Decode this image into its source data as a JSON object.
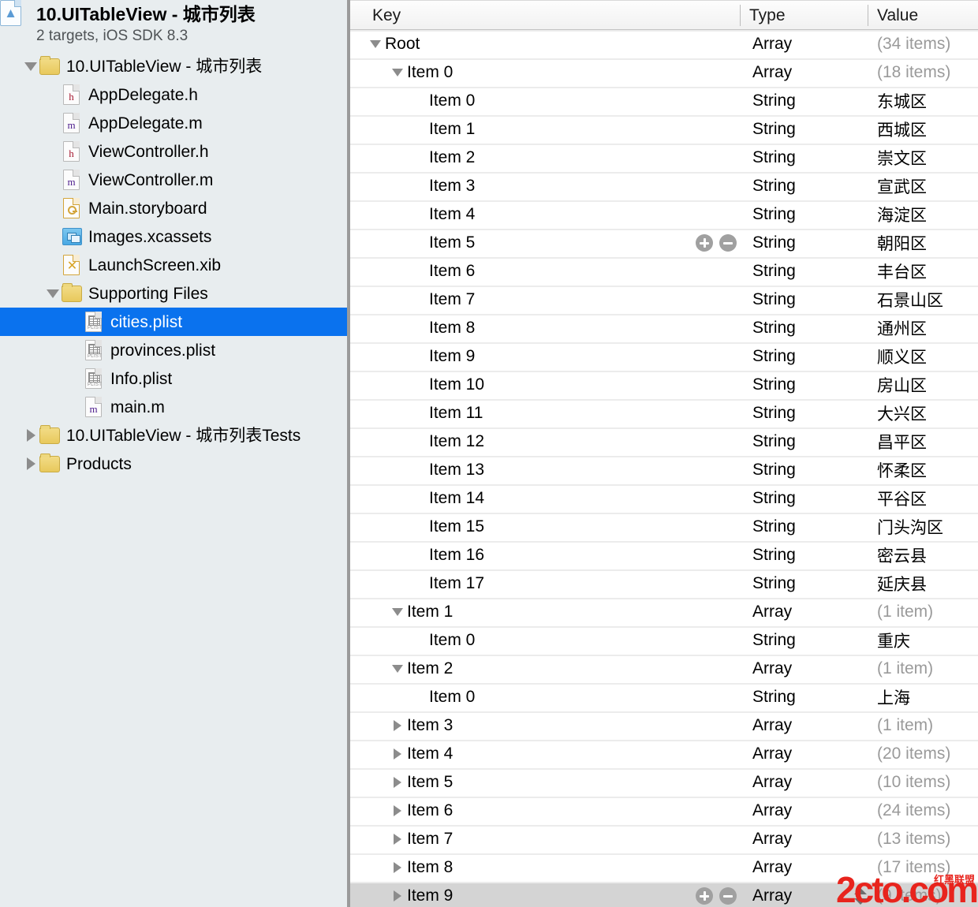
{
  "sidebar": {
    "project": {
      "title": "10.UITableView - 城市列表",
      "subtitle": "2 targets, iOS SDK 8.3",
      "icon": "xcode-project-icon"
    },
    "items": [
      {
        "label": "10.UITableView - 城市列表",
        "icon": "folder-icon",
        "depth": 1,
        "twisty": "down",
        "selected": false
      },
      {
        "label": "AppDelegate.h",
        "icon": "header-file-icon",
        "depth": 2,
        "twisty": "none",
        "selected": false
      },
      {
        "label": "AppDelegate.m",
        "icon": "objc-file-icon",
        "depth": 2,
        "twisty": "none",
        "selected": false
      },
      {
        "label": "ViewController.h",
        "icon": "header-file-icon",
        "depth": 2,
        "twisty": "none",
        "selected": false
      },
      {
        "label": "ViewController.m",
        "icon": "objc-file-icon",
        "depth": 2,
        "twisty": "none",
        "selected": false
      },
      {
        "label": "Main.storyboard",
        "icon": "storyboard-icon",
        "depth": 2,
        "twisty": "none",
        "selected": false
      },
      {
        "label": "Images.xcassets",
        "icon": "xcassets-icon",
        "depth": 2,
        "twisty": "none",
        "selected": false
      },
      {
        "label": "LaunchScreen.xib",
        "icon": "xib-icon",
        "depth": 2,
        "twisty": "none",
        "selected": false
      },
      {
        "label": "Supporting Files",
        "icon": "folder-icon",
        "depth": 2,
        "twisty": "down",
        "selected": false
      },
      {
        "label": "cities.plist",
        "icon": "plist-icon",
        "depth": 3,
        "twisty": "none",
        "selected": true
      },
      {
        "label": "provinces.plist",
        "icon": "plist-icon",
        "depth": 3,
        "twisty": "none",
        "selected": false
      },
      {
        "label": "Info.plist",
        "icon": "plist-icon",
        "depth": 3,
        "twisty": "none",
        "selected": false
      },
      {
        "label": "main.m",
        "icon": "objc-file-icon",
        "depth": 3,
        "twisty": "none",
        "selected": false
      },
      {
        "label": "10.UITableView - 城市列表Tests",
        "icon": "folder-icon",
        "depth": 1,
        "twisty": "right",
        "selected": false
      },
      {
        "label": "Products",
        "icon": "folder-icon",
        "depth": 1,
        "twisty": "right",
        "selected": false
      }
    ]
  },
  "table": {
    "columns": {
      "key": "Key",
      "type": "Type",
      "value": "Value"
    },
    "rows": [
      {
        "key": "Root",
        "type": "Array",
        "value": "(34 items)",
        "depth": 0,
        "twisty": "down",
        "muted": true,
        "selected": false,
        "buttons": false,
        "stepper": false
      },
      {
        "key": "Item 0",
        "type": "Array",
        "value": "(18 items)",
        "depth": 1,
        "twisty": "down",
        "muted": true,
        "selected": false,
        "buttons": false,
        "stepper": false
      },
      {
        "key": "Item 0",
        "type": "String",
        "value": "东城区",
        "depth": 2,
        "twisty": "none",
        "muted": false,
        "selected": false,
        "buttons": false,
        "stepper": false
      },
      {
        "key": "Item 1",
        "type": "String",
        "value": "西城区",
        "depth": 2,
        "twisty": "none",
        "muted": false,
        "selected": false,
        "buttons": false,
        "stepper": false
      },
      {
        "key": "Item 2",
        "type": "String",
        "value": "崇文区",
        "depth": 2,
        "twisty": "none",
        "muted": false,
        "selected": false,
        "buttons": false,
        "stepper": false
      },
      {
        "key": "Item 3",
        "type": "String",
        "value": "宣武区",
        "depth": 2,
        "twisty": "none",
        "muted": false,
        "selected": false,
        "buttons": false,
        "stepper": false
      },
      {
        "key": "Item 4",
        "type": "String",
        "value": "海淀区",
        "depth": 2,
        "twisty": "none",
        "muted": false,
        "selected": false,
        "buttons": false,
        "stepper": false
      },
      {
        "key": "Item 5",
        "type": "String",
        "value": "朝阳区",
        "depth": 2,
        "twisty": "none",
        "muted": false,
        "selected": false,
        "buttons": true,
        "stepper": false
      },
      {
        "key": "Item 6",
        "type": "String",
        "value": "丰台区",
        "depth": 2,
        "twisty": "none",
        "muted": false,
        "selected": false,
        "buttons": false,
        "stepper": false
      },
      {
        "key": "Item 7",
        "type": "String",
        "value": "石景山区",
        "depth": 2,
        "twisty": "none",
        "muted": false,
        "selected": false,
        "buttons": false,
        "stepper": false
      },
      {
        "key": "Item 8",
        "type": "String",
        "value": "通州区",
        "depth": 2,
        "twisty": "none",
        "muted": false,
        "selected": false,
        "buttons": false,
        "stepper": false
      },
      {
        "key": "Item 9",
        "type": "String",
        "value": "顺义区",
        "depth": 2,
        "twisty": "none",
        "muted": false,
        "selected": false,
        "buttons": false,
        "stepper": false
      },
      {
        "key": "Item 10",
        "type": "String",
        "value": "房山区",
        "depth": 2,
        "twisty": "none",
        "muted": false,
        "selected": false,
        "buttons": false,
        "stepper": false
      },
      {
        "key": "Item 11",
        "type": "String",
        "value": "大兴区",
        "depth": 2,
        "twisty": "none",
        "muted": false,
        "selected": false,
        "buttons": false,
        "stepper": false
      },
      {
        "key": "Item 12",
        "type": "String",
        "value": "昌平区",
        "depth": 2,
        "twisty": "none",
        "muted": false,
        "selected": false,
        "buttons": false,
        "stepper": false
      },
      {
        "key": "Item 13",
        "type": "String",
        "value": "怀柔区",
        "depth": 2,
        "twisty": "none",
        "muted": false,
        "selected": false,
        "buttons": false,
        "stepper": false
      },
      {
        "key": "Item 14",
        "type": "String",
        "value": "平谷区",
        "depth": 2,
        "twisty": "none",
        "muted": false,
        "selected": false,
        "buttons": false,
        "stepper": false
      },
      {
        "key": "Item 15",
        "type": "String",
        "value": "门头沟区",
        "depth": 2,
        "twisty": "none",
        "muted": false,
        "selected": false,
        "buttons": false,
        "stepper": false
      },
      {
        "key": "Item 16",
        "type": "String",
        "value": "密云县",
        "depth": 2,
        "twisty": "none",
        "muted": false,
        "selected": false,
        "buttons": false,
        "stepper": false
      },
      {
        "key": "Item 17",
        "type": "String",
        "value": "延庆县",
        "depth": 2,
        "twisty": "none",
        "muted": false,
        "selected": false,
        "buttons": false,
        "stepper": false
      },
      {
        "key": "Item 1",
        "type": "Array",
        "value": "(1 item)",
        "depth": 1,
        "twisty": "down",
        "muted": true,
        "selected": false,
        "buttons": false,
        "stepper": false
      },
      {
        "key": "Item 0",
        "type": "String",
        "value": "重庆",
        "depth": 2,
        "twisty": "none",
        "muted": false,
        "selected": false,
        "buttons": false,
        "stepper": false
      },
      {
        "key": "Item 2",
        "type": "Array",
        "value": "(1 item)",
        "depth": 1,
        "twisty": "down",
        "muted": true,
        "selected": false,
        "buttons": false,
        "stepper": false
      },
      {
        "key": "Item 0",
        "type": "String",
        "value": "上海",
        "depth": 2,
        "twisty": "none",
        "muted": false,
        "selected": false,
        "buttons": false,
        "stepper": false
      },
      {
        "key": "Item 3",
        "type": "Array",
        "value": "(1 item)",
        "depth": 1,
        "twisty": "right",
        "muted": true,
        "selected": false,
        "buttons": false,
        "stepper": false
      },
      {
        "key": "Item 4",
        "type": "Array",
        "value": "(20 items)",
        "depth": 1,
        "twisty": "right",
        "muted": true,
        "selected": false,
        "buttons": false,
        "stepper": false
      },
      {
        "key": "Item 5",
        "type": "Array",
        "value": "(10 items)",
        "depth": 1,
        "twisty": "right",
        "muted": true,
        "selected": false,
        "buttons": false,
        "stepper": false
      },
      {
        "key": "Item 6",
        "type": "Array",
        "value": "(24 items)",
        "depth": 1,
        "twisty": "right",
        "muted": true,
        "selected": false,
        "buttons": false,
        "stepper": false
      },
      {
        "key": "Item 7",
        "type": "Array",
        "value": "(13 items)",
        "depth": 1,
        "twisty": "right",
        "muted": true,
        "selected": false,
        "buttons": false,
        "stepper": false
      },
      {
        "key": "Item 8",
        "type": "Array",
        "value": "(17 items)",
        "depth": 1,
        "twisty": "right",
        "muted": true,
        "selected": false,
        "buttons": false,
        "stepper": false
      },
      {
        "key": "Item 9",
        "type": "Array",
        "value": "(9 items)",
        "depth": 1,
        "twisty": "right",
        "muted": true,
        "selected": true,
        "buttons": true,
        "stepper": true
      }
    ]
  },
  "watermark": {
    "main": "2cto.com",
    "cn": "红黑联盟",
    "color": "#e8241d"
  },
  "colors": {
    "selection_blue": "#0A72EE",
    "sidebar_bg": "#E8EDEF",
    "row_separator": "#ECECEC",
    "inactive_selection": "#D4D4D4"
  }
}
